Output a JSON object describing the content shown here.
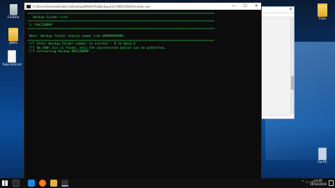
{
  "desktop": {
    "icons_left": [
      {
        "label": "Cestino",
        "kind": "bin"
      },
      {
        "label": "JMRS",
        "kind": "folder"
      },
      {
        "label": "Tubo Extract",
        "kind": "doc"
      }
    ],
    "icons_right": [
      {
        "label": "Files",
        "kind": "folder"
      },
      {
        "label": "Go PC",
        "kind": "doc"
      }
    ]
  },
  "console": {
    "title": "C:\\Users\\Andreea\\OneDrive\\Desktop\\NAVACPU\\Backup.8.8.1098\\100401\\master.exe",
    "controls": {
      "minimize": "—",
      "maximize": "☐",
      "close": "✕"
    },
    "lines": {
      "sep1": "=================================================================================================",
      "header": "   Backup Folder List",
      "sep2": "=================================================================================================",
      "item1": " 1. PUL5309HP",
      "sep3": "=================================================================================================",
      "note": " Note: Backup folder should named like ########AM1.",
      "sep4": "=================================================================================================",
      "msg1": " [*] Enter Backup Folder number to extract : 0 to Back:4",
      "msg2": " [*] No DAB+.bin is found, only the unprotected option can be patherlea.",
      "msg3": " [*] Extracting Backup PUL5309HP ..."
    }
  },
  "taskbar": {
    "tray_text": "^ ▭ ◁)",
    "time": "14:45",
    "date": "11/10/2016"
  }
}
